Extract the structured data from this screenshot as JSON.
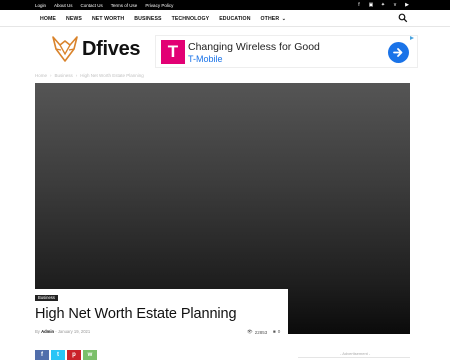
{
  "topbar": {
    "links": [
      "Login",
      "About Us",
      "Contact Us",
      "Terms of Use",
      "Privacy Policy"
    ],
    "social_icons": [
      "facebook-icon",
      "instagram-icon",
      "twitter-icon",
      "vimeo-icon",
      "youtube-icon"
    ]
  },
  "nav": {
    "items": [
      "HOME",
      "NEWS",
      "NET WORTH",
      "BUSINESS",
      "TECHNOLOGY",
      "EDUCATION",
      "OTHER"
    ],
    "search_icon": "search-icon"
  },
  "logo": {
    "name": "Dfives",
    "brand_color": "#d9832b"
  },
  "ad": {
    "headline": "Changing Wireless for Good",
    "advertiser": "T-Mobile",
    "brand_color": "#e20074",
    "cta_color": "#1a73e8"
  },
  "breadcrumb": [
    "Home",
    "Business",
    "High Net Worth Estate Planning"
  ],
  "article": {
    "category": "Business",
    "title": "High Net Worth Estate Planning",
    "by_label": "By",
    "author": "Admin",
    "date": "January 19, 2021",
    "views": "22853",
    "comments": "0"
  },
  "share_colors": [
    "#516eab",
    "#29c5f6",
    "#ca212a",
    "#7bbf6a"
  ],
  "sidebar": {
    "ad_label": "- Advertisement -"
  }
}
